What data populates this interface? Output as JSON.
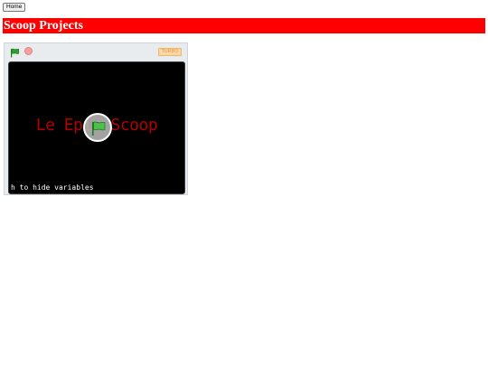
{
  "header": {
    "home_label": "Home",
    "title": "Scoop Projects"
  },
  "player": {
    "turbo_label": "TURBO",
    "stage_title": "Le Epic Scoop",
    "stage_hint": "h to hide variables",
    "colors": {
      "flag": "#2e9e2e",
      "stop": "#f2a0a0",
      "stage_bg": "#000000",
      "title_text": "#b30000"
    }
  }
}
